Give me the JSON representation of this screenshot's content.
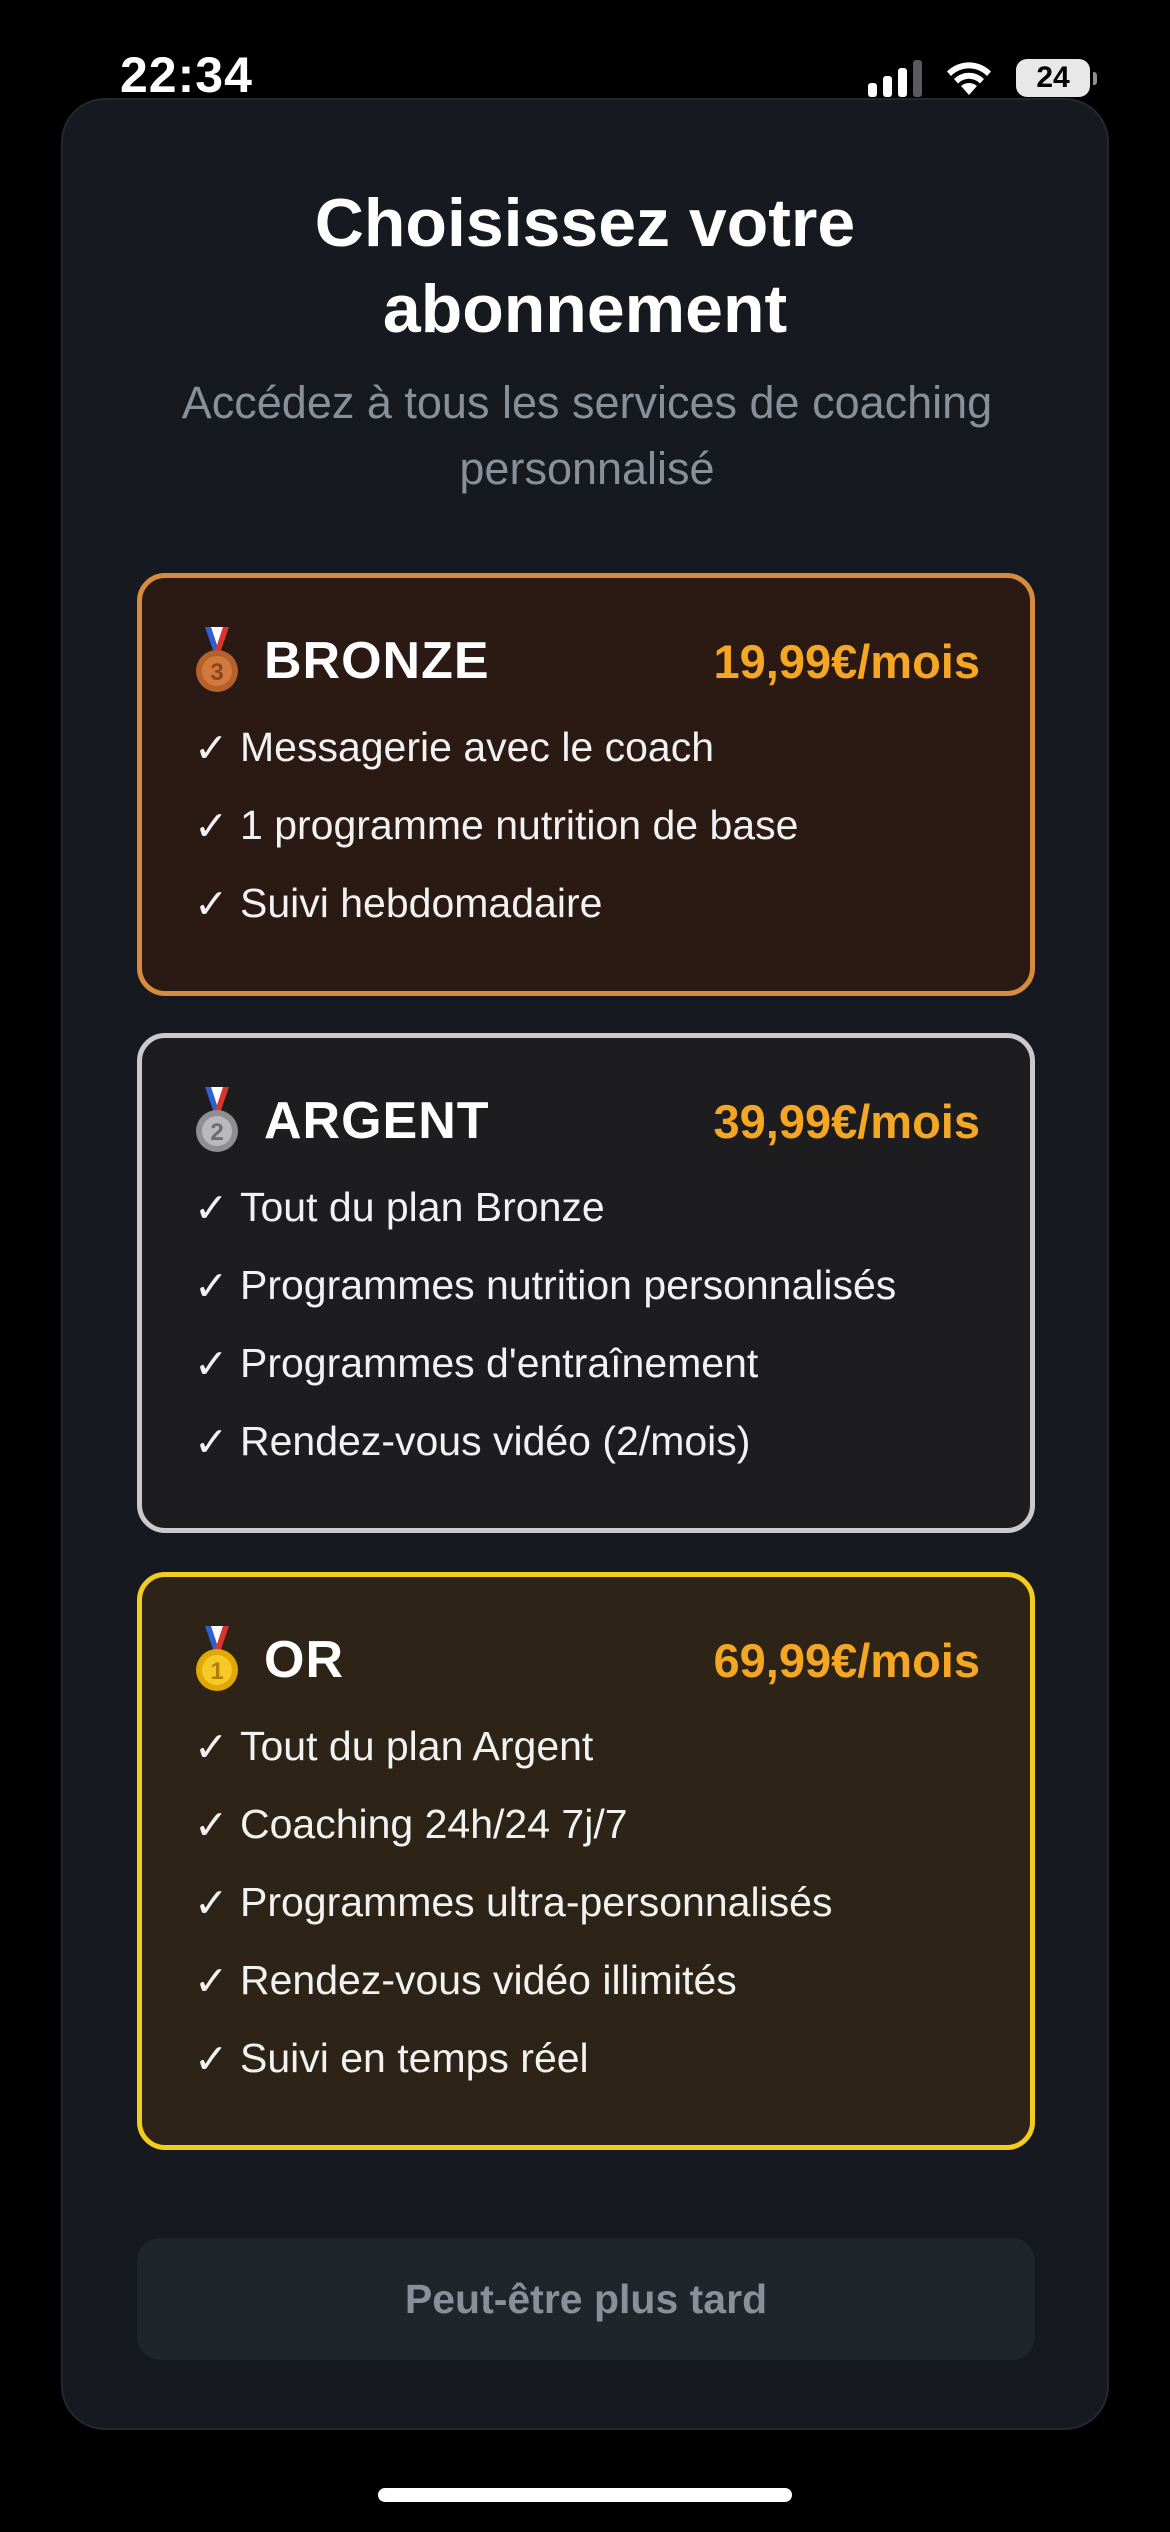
{
  "status_bar": {
    "time": "22:34",
    "battery": "24",
    "icons": [
      "signal-icon",
      "wifi-icon",
      "battery-icon"
    ]
  },
  "header": {
    "title_line1": "Choisissez votre",
    "title_line2": "abonnement",
    "subtitle": "Accédez à tous les services de coaching personnalisé"
  },
  "plans": [
    {
      "icon": "bronze-medal-icon",
      "name": "BRONZE",
      "price": "19,99€/mois",
      "accent_color": "#d88b3e",
      "features": [
        "Messagerie avec le coach",
        "1 programme nutrition de base",
        "Suivi hebdomadaire"
      ]
    },
    {
      "icon": "silver-medal-icon",
      "name": "ARGENT",
      "price": "39,99€/mois",
      "accent_color": "#c9c9cf",
      "features": [
        "Tout du plan Bronze",
        "Programmes nutrition personnalisés",
        "Programmes d'entraînement",
        "Rendez-vous vidéo (2/mois)"
      ]
    },
    {
      "icon": "gold-medal-icon",
      "name": "OR",
      "price": "69,99€/mois",
      "accent_color": "#f2cd1b",
      "features": [
        "Tout du plan Argent",
        "Coaching 24h/24 7j/7",
        "Programmes ultra-personnalisés",
        "Rendez-vous vidéo illimités",
        "Suivi en temps réel"
      ]
    }
  ],
  "check_mark": "✓",
  "price_color": "#f5a623",
  "later_button_label": "Peut-être plus tard"
}
